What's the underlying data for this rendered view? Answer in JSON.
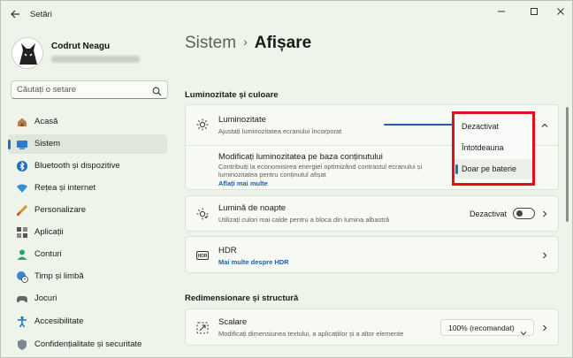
{
  "window": {
    "title": "Setări",
    "controls": [
      "minimize-icon",
      "maximize-icon",
      "close-icon"
    ]
  },
  "user": {
    "name": "Codrut Neagu"
  },
  "search": {
    "placeholder": "Căutați o setare"
  },
  "sidebar": {
    "items": [
      {
        "label": "Acasă",
        "icon": "home-icon",
        "active": false
      },
      {
        "label": "Sistem",
        "icon": "monitor-icon",
        "active": true
      },
      {
        "label": "Bluetooth și dispozitive",
        "icon": "bluetooth-icon",
        "active": false
      },
      {
        "label": "Rețea și internet",
        "icon": "wifi-icon",
        "active": false
      },
      {
        "label": "Personalizare",
        "icon": "brush-icon",
        "active": false
      },
      {
        "label": "Aplicații",
        "icon": "apps-icon",
        "active": false
      },
      {
        "label": "Conturi",
        "icon": "person-icon",
        "active": false
      },
      {
        "label": "Timp și limbă",
        "icon": "globe-clock-icon",
        "active": false
      },
      {
        "label": "Jocuri",
        "icon": "gamepad-icon",
        "active": false
      },
      {
        "label": "Accesibilitate",
        "icon": "accessibility-icon",
        "active": false
      },
      {
        "label": "Confidențialitate și securitate",
        "icon": "shield-icon",
        "active": false
      }
    ]
  },
  "breadcrumb": {
    "parent": "Sistem",
    "separator": "›",
    "current": "Afișare"
  },
  "sections": {
    "brightness_color": "Luminozitate și culoare",
    "scale_layout": "Redimensionare și structură"
  },
  "brightness": {
    "title": "Luminozitate",
    "subtitle": "Ajustați luminozitatea ecranului încorporat",
    "adaptive_title": "Modificați luminozitatea pe baza conținutului",
    "adaptive_sub1": "Contribuiți la economisirea energiei optimizând contrastul ecranului și",
    "adaptive_sub2": "luminozitatea pentru conținutul afișat",
    "adaptive_link": "Aflați mai multe"
  },
  "dropdown": {
    "options": [
      "Dezactivat",
      "Întotdeauna",
      "Doar pe baterie"
    ],
    "selected_index": 2
  },
  "night_light": {
    "title": "Lumină de noapte",
    "subtitle": "Utilizați culori mai calde pentru a bloca din lumina albastră",
    "toggle_label": "Dezactivat",
    "toggle_on": false
  },
  "hdr": {
    "title": "HDR",
    "link": "Mai multe despre HDR"
  },
  "scale": {
    "title": "Scalare",
    "subtitle": "Modificați dimensiunea textului, a aplicațiilor și a altor elemente",
    "value": "100% (recomandat)"
  },
  "colors": {
    "accent": "#1f6fc0",
    "link": "#1f5fa8",
    "highlight": "#e0101a",
    "background": "#eef4ea"
  }
}
